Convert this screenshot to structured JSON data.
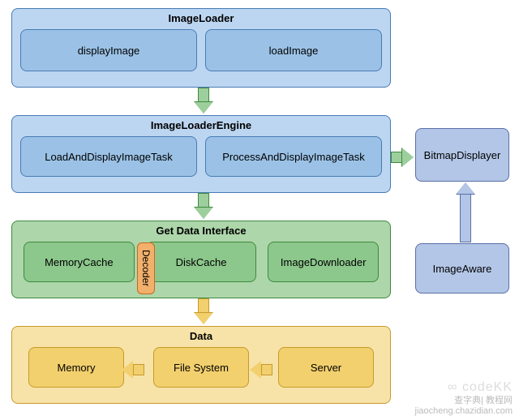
{
  "imageLoader": {
    "title": "ImageLoader",
    "items": [
      "displayImage",
      "loadImage"
    ]
  },
  "engine": {
    "title": "ImageLoaderEngine",
    "items": [
      "LoadAndDisplayImageTask",
      "ProcessAndDisplayImageTask"
    ]
  },
  "getData": {
    "title": "Get Data Interface",
    "items": [
      "MemoryCache",
      "DiskCache",
      "ImageDownloader"
    ],
    "decoder": "Decoder"
  },
  "data": {
    "title": "Data",
    "items": [
      "Memory",
      "File System",
      "Server"
    ]
  },
  "side": {
    "displayer": "BitmapDisplayer",
    "aware": "ImageAware"
  },
  "watermark": {
    "cc": "∞ codeKK",
    "site": "查字典| 教程网",
    "url": "jiaocheng.chazidian.com"
  }
}
